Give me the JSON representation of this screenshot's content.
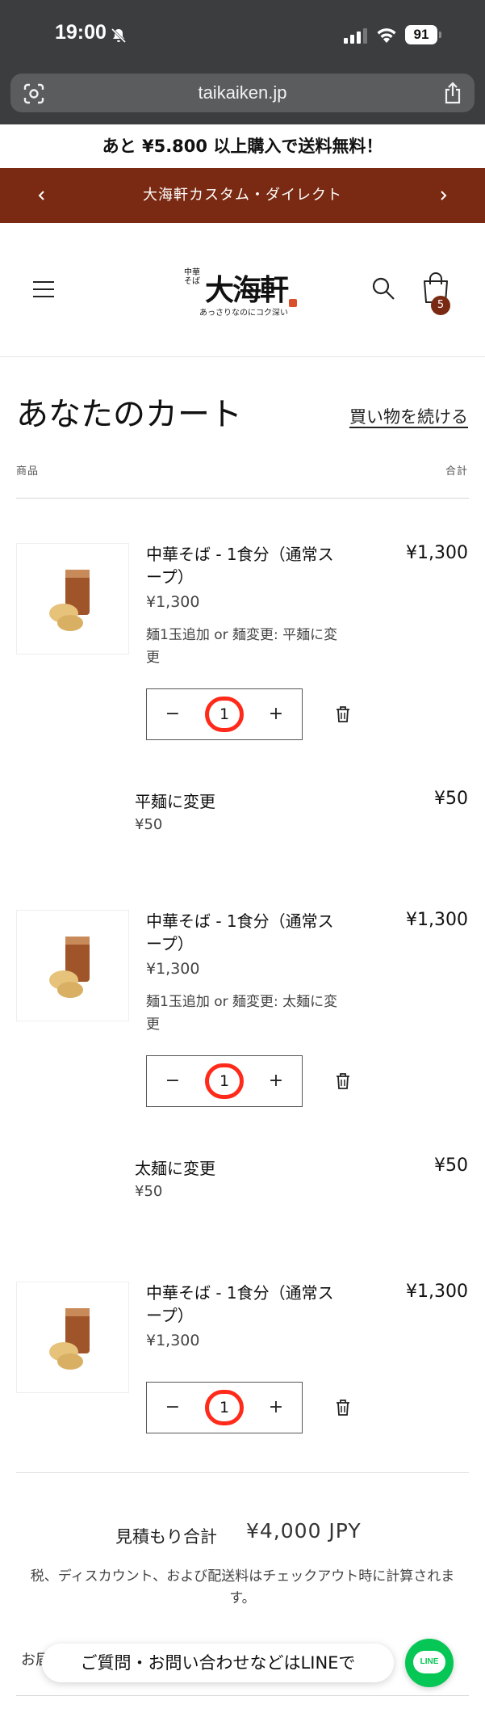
{
  "status_bar": {
    "time": "19:00",
    "battery": "91"
  },
  "browser": {
    "url": "taikaiken.jp"
  },
  "announcement": {
    "shipping": "あと ¥5.800 以上購入で送料無料！",
    "promo": "大海軒カスタム・ダイレクト"
  },
  "header": {
    "logo_main": "大海軒",
    "logo_side": "中華そば",
    "logo_tagline": "あっさりなのにコク深い",
    "cart_count": "5"
  },
  "cart": {
    "title": "あなたのカート",
    "continue_label": "買い物を続ける",
    "col_product": "商品",
    "col_total": "合計",
    "items": [
      {
        "title": "中華そば - 1食分（通常スープ）",
        "price": "¥1,300",
        "option": "麺1玉追加 or 麺変更: 平麺に変更",
        "total": "¥1,300",
        "qty_minus": "−",
        "qty": "1",
        "qty_plus": "+",
        "addon_title": "平麺に変更",
        "addon_price": "¥50",
        "addon_total": "¥50"
      },
      {
        "title": "中華そば - 1食分（通常スープ）",
        "price": "¥1,300",
        "option": "麺1玉追加 or 麺変更: 太麺に変更",
        "total": "¥1,300",
        "qty_minus": "−",
        "qty": "1",
        "qty_plus": "+",
        "addon_title": "太麺に変更",
        "addon_price": "¥50",
        "addon_total": "¥50"
      },
      {
        "title": "中華そば - 1食分（通常スープ）",
        "price": "¥1,300",
        "total": "¥1,300",
        "qty_minus": "−",
        "qty": "1",
        "qty_plus": "+"
      }
    ],
    "subtotal_label": "見積もり合計",
    "subtotal_value": "¥4,000 JPY",
    "tax_note": "税、ディスカウント、および配送料はチェックアウト時に計算されます。",
    "cut_text": "お届"
  },
  "line_widget": {
    "banner": "ご質問・お問い合わせなどはLINEで",
    "button_label": "LINE",
    "color": "#06c755"
  },
  "colors": {
    "accent": "#7a2a12",
    "highlight": "#ff2a1a"
  }
}
